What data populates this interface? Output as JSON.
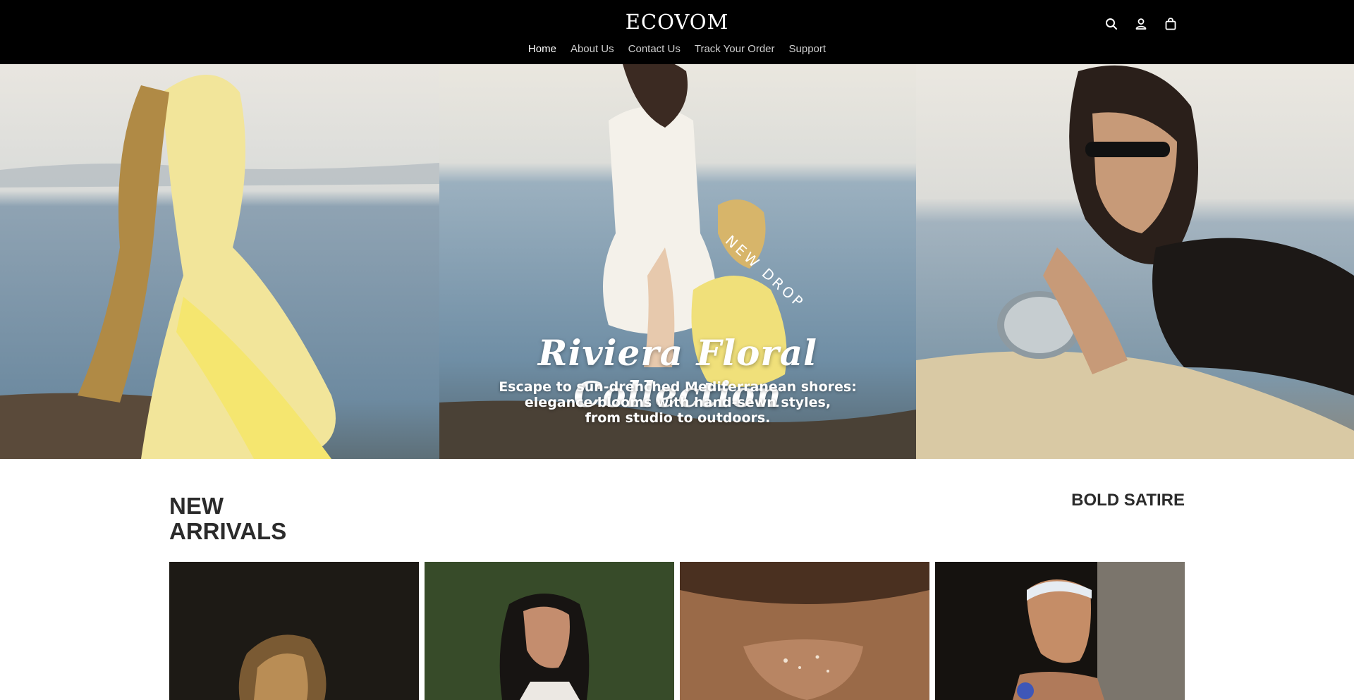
{
  "header": {
    "logo": "ECOVOM",
    "nav": [
      {
        "label": "Home",
        "active": true
      },
      {
        "label": "About Us",
        "active": false
      },
      {
        "label": "Contact Us",
        "active": false
      },
      {
        "label": "Track Your Order",
        "active": false
      },
      {
        "label": "Support",
        "active": false
      }
    ],
    "icons": [
      "search-icon",
      "account-icon",
      "cart-icon"
    ]
  },
  "hero": {
    "badge": "NEW DROP",
    "title": "Riviera Floral Collection",
    "subtitle_lines": [
      "Escape to sun-drenched Mediterranean shores:",
      "elegance blooms with hand-sewn styles,",
      "from studio to outdoors."
    ]
  },
  "section": {
    "title_line1": "NEW",
    "title_line2": "ARRIVALS",
    "right_label": "BOLD SATIRE"
  },
  "colors": {
    "header_bg": "#000000",
    "nav_active": "#ffffff",
    "nav_inactive": "#cfcfcf",
    "heading": "#2b2b2b"
  }
}
